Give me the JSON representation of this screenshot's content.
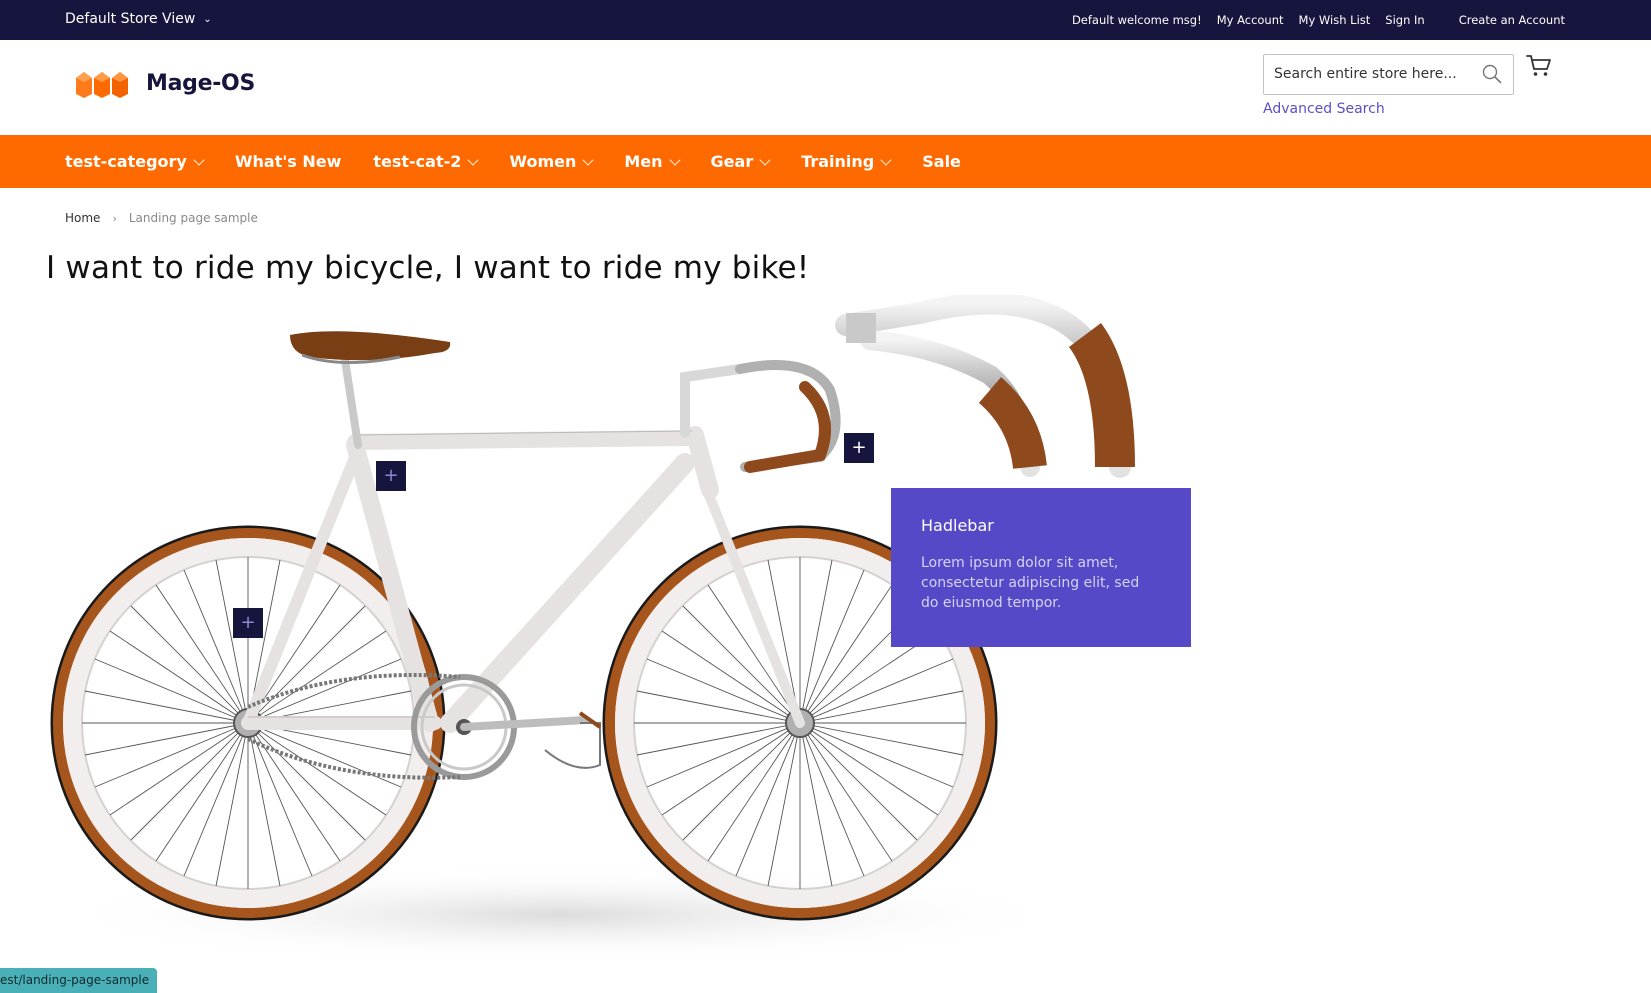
{
  "topbar": {
    "store_view": "Default Store View",
    "welcome": "Default welcome msg!",
    "links": [
      "My Account",
      "My Wish List",
      "Sign In"
    ],
    "create_account": "Create an Account"
  },
  "header": {
    "logo_text": "Mage-OS",
    "search_placeholder": "Search entire store here...",
    "advanced_search": "Advanced Search"
  },
  "nav": {
    "items": [
      {
        "label": "test-category",
        "dropdown": true
      },
      {
        "label": "What's New",
        "dropdown": false
      },
      {
        "label": "test-cat-2",
        "dropdown": true
      },
      {
        "label": "Women",
        "dropdown": true
      },
      {
        "label": "Men",
        "dropdown": true
      },
      {
        "label": "Gear",
        "dropdown": true
      },
      {
        "label": "Training",
        "dropdown": true
      },
      {
        "label": "Sale",
        "dropdown": false
      }
    ]
  },
  "breadcrumb": {
    "home": "Home",
    "separator": "›",
    "current": "Landing page sample"
  },
  "page": {
    "title": "I want to ride my bicycle, I want to ride my bike!"
  },
  "hotspots": {
    "symbol": "+"
  },
  "info_card": {
    "title": "Hadlebar",
    "description": "Lorem ipsum dolor sit amet, consectetur adipiscing elit, sed do eiusmod tempor."
  },
  "status_bar": {
    "url": "est/landing-page-sample"
  },
  "colors": {
    "topbar": "#15153d",
    "nav": "#ff6a00",
    "accent_link": "#5b4fc7",
    "info_card": "#5549c8",
    "hotspot": "#15153d"
  }
}
